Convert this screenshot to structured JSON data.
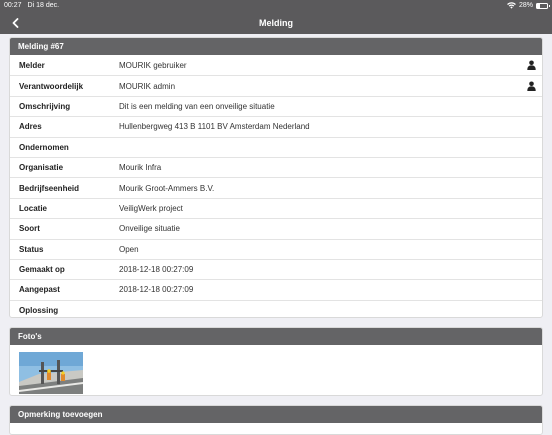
{
  "status_bar": {
    "time": "00:27",
    "date": "Di 18 dec.",
    "battery": "28%",
    "battery_level": 0.28
  },
  "navbar": {
    "title": "Melding"
  },
  "details": {
    "header": "Melding #67",
    "rows": [
      {
        "label": "Melder",
        "value": "MOURIK gebruiker",
        "icon": "user-icon"
      },
      {
        "label": "Verantwoordelijk",
        "value": "MOURIK admin",
        "icon": "user-icon"
      },
      {
        "label": "Omschrijving",
        "value": "Dit is een melding van een onveilige situatie"
      },
      {
        "label": "Adres",
        "value": "Hullenbergweg 413 B 1101 BV Amsterdam Nederland"
      },
      {
        "label": "Ondernomen",
        "value": ""
      },
      {
        "label": "Organisatie",
        "value": "Mourik Infra"
      },
      {
        "label": "Bedrijfseenheid",
        "value": "Mourik Groot-Ammers B.V."
      },
      {
        "label": "Locatie",
        "value": "VeiligWerk project"
      },
      {
        "label": "Soort",
        "value": "Onveilige situatie"
      },
      {
        "label": "Status",
        "value": "Open"
      },
      {
        "label": "Gemaakt op",
        "value": "2018-12-18 00:27:09"
      },
      {
        "label": "Aangepast",
        "value": "2018-12-18 00:27:09"
      },
      {
        "label": "Oplossing",
        "value": ""
      }
    ]
  },
  "photos": {
    "header": "Foto's"
  },
  "comment": {
    "header": "Opmerking toevoegen"
  }
}
